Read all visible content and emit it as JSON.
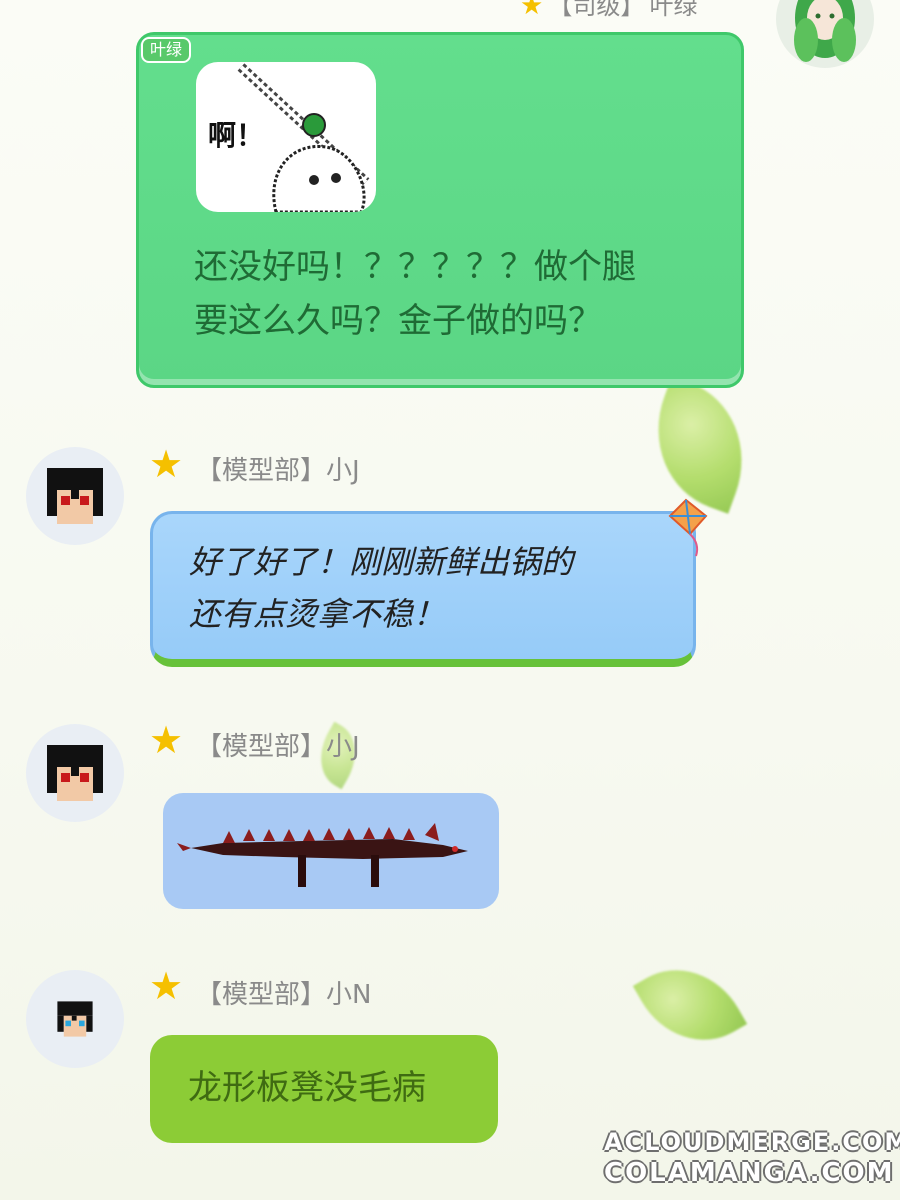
{
  "top_partial_header": {
    "rank_label": "【司级】",
    "name": "叶绿"
  },
  "messages": [
    {
      "sender_side": "right",
      "bubble_badge": "叶绿",
      "sticker_caption": "啊！",
      "text": "还没好吗！？？？？？做个腿\n要这么久吗？金子做的吗？"
    },
    {
      "sender_side": "left",
      "rank": "【模型部】",
      "name": "小J",
      "text": "好了好了！刚刚新鲜出锅的\n还有点烫拿不稳！"
    },
    {
      "sender_side": "left",
      "rank": "【模型部】",
      "name": "小J",
      "image_desc": "dragon-bench-model"
    },
    {
      "sender_side": "left",
      "rank": "【模型部】",
      "name": "小N",
      "text": "龙形板凳没毛病"
    }
  ],
  "watermark": {
    "line1": "ACLOUDMERGE.COM",
    "line2": "COLAMANGA.COM"
  },
  "colors": {
    "green_bubble": "#5fdc86",
    "blue_bubble": "#9fd0fa",
    "lime_bubble": "#8ccc36",
    "image_bubble": "#a8c9f4",
    "star": "#f5c000"
  }
}
